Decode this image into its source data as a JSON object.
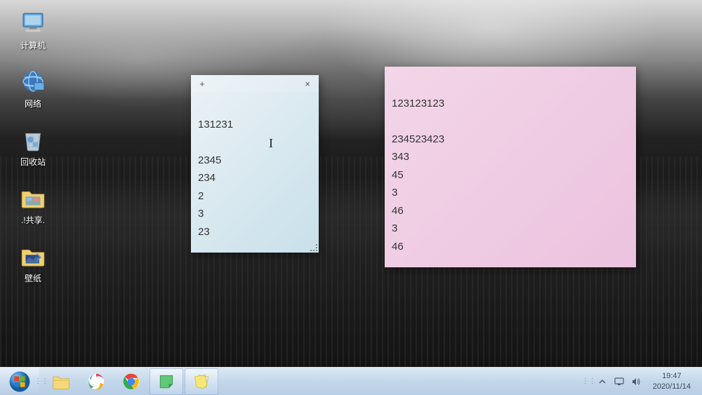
{
  "desktop_icons": [
    {
      "label": "计算机",
      "name": "computer"
    },
    {
      "label": "网络",
      "name": "network"
    },
    {
      "label": "回收站",
      "name": "recycle-bin"
    },
    {
      "label": ".!共享.",
      "name": "share-folder"
    },
    {
      "label": "壁纸",
      "name": "wallpaper-folder"
    }
  ],
  "sticky_blue": {
    "lines": "131231\n\n2345\n234\n2\n3\n23"
  },
  "sticky_pink": {
    "lines": "123123123\n\n234523423\n343\n45\n3\n46\n3\n46"
  },
  "taskbar": {
    "items": [
      {
        "name": "explorer",
        "active": false
      },
      {
        "name": "browser-swirl",
        "active": false
      },
      {
        "name": "chrome",
        "active": false
      },
      {
        "name": "sticky-notes-1",
        "active": true
      },
      {
        "name": "sticky-notes-2",
        "active": true
      }
    ]
  },
  "systray": {
    "time": "19:47",
    "date": "2020/11/14"
  }
}
